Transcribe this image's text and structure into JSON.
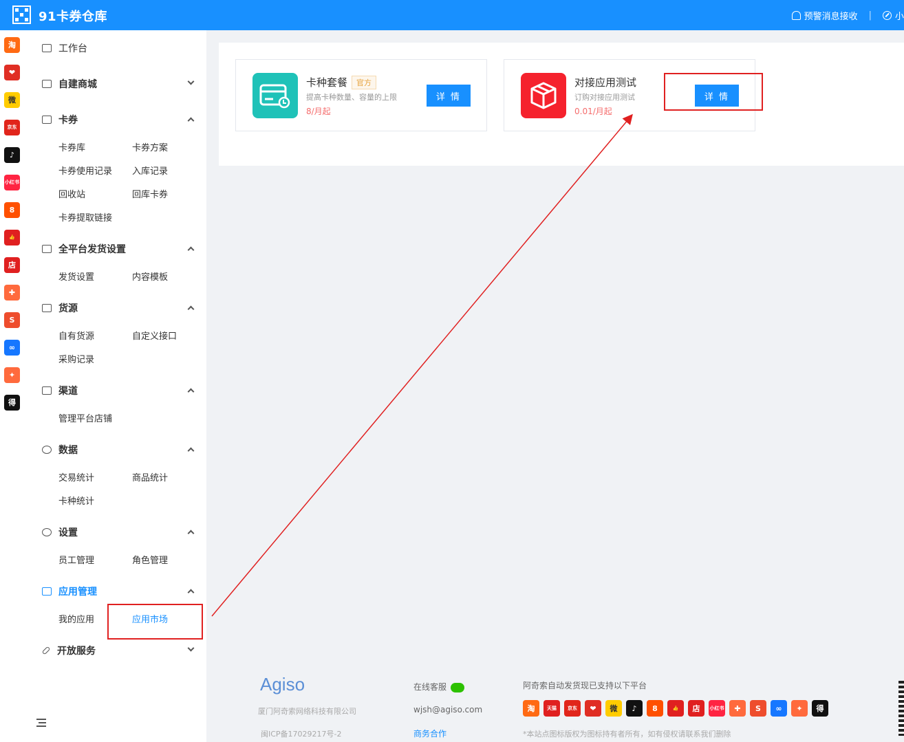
{
  "header": {
    "title": "91卡券仓库",
    "alert_label": "预警消息接收",
    "separator": "|",
    "user_label": "小"
  },
  "platform_strip": [
    {
      "icon": "taobao-icon",
      "glyph": "淘",
      "color": "#ff6a13"
    },
    {
      "icon": "pinduoduo-icon",
      "glyph": "❤",
      "color": "#e02e24"
    },
    {
      "icon": "weimob-icon",
      "glyph": "微",
      "color": "#ffcc00"
    },
    {
      "icon": "jd-icon",
      "glyph": "京东",
      "color": "#e1251b"
    },
    {
      "icon": "douyin-icon",
      "glyph": "♪",
      "color": "#111111"
    },
    {
      "icon": "xiaohongshu-icon",
      "glyph": "小红书",
      "color": "#ff2442"
    },
    {
      "icon": "kuaishou-icon",
      "glyph": "8",
      "color": "#ff5000"
    },
    {
      "icon": "thumbs-up-icon",
      "glyph": "👍",
      "color": "#e02020"
    },
    {
      "icon": "shop-icon",
      "glyph": "店",
      "color": "#e02020"
    },
    {
      "icon": "bag-icon",
      "glyph": "✚",
      "color": "#ff6a3d"
    },
    {
      "icon": "shopee-icon",
      "glyph": "S",
      "color": "#ee4d2d"
    },
    {
      "icon": "link-icon",
      "glyph": "∞",
      "color": "#1677ff"
    },
    {
      "icon": "gift-icon",
      "glyph": "✦",
      "color": "#ff6a3d"
    },
    {
      "icon": "dewu-icon",
      "glyph": "得",
      "color": "#111111"
    }
  ],
  "sidebar": {
    "workbench": "工作台",
    "sections": [
      {
        "label": "自建商城",
        "expanded": false,
        "items": []
      },
      {
        "label": "卡券",
        "expanded": true,
        "items": [
          "卡券库",
          "卡券方案",
          "卡券使用记录",
          "入库记录",
          "回收站",
          "回库卡券",
          "卡券提取链接"
        ]
      },
      {
        "label": "全平台发货设置",
        "expanded": true,
        "items": [
          "发货设置",
          "内容模板"
        ]
      },
      {
        "label": "货源",
        "expanded": true,
        "items": [
          "自有货源",
          "自定义接口",
          "采购记录"
        ]
      },
      {
        "label": "渠道",
        "expanded": true,
        "items": [
          "管理平台店铺"
        ]
      },
      {
        "label": "数据",
        "expanded": true,
        "items": [
          "交易统计",
          "商品统计",
          "卡种统计"
        ]
      },
      {
        "label": "设置",
        "expanded": true,
        "items": [
          "员工管理",
          "角色管理"
        ]
      },
      {
        "label": "应用管理",
        "expanded": true,
        "active": true,
        "items": [
          "我的应用",
          "应用市场"
        ],
        "active_item": "应用市场"
      },
      {
        "label": "开放服务",
        "expanded": false,
        "items": []
      }
    ]
  },
  "apps": [
    {
      "name": "卡种套餐",
      "badge": "官方",
      "desc": "提高卡种数量、容量的上限",
      "price": "8/月起",
      "button": "详 情",
      "icon": "card-package-icon",
      "color": "#1fc2b8"
    },
    {
      "name": "对接应用测试",
      "badge": "",
      "desc": "订购对接应用测试",
      "price": "0.01/月起",
      "button": "详 情",
      "icon": "cube-icon",
      "color": "#f5222d"
    }
  ],
  "footer": {
    "brand": "Agiso",
    "company": "厦门阿奇索网络科技有限公司",
    "icp": "闽ICP备17029217号-2",
    "service": "在线客服",
    "email": "wjsh@agiso.com",
    "business": "商务合作",
    "platforms_title": "阿奇索自动发货现已支持以下平台",
    "disclaimer": "*本站点图标版权为图标持有者所有，如有侵权请联系我们删除",
    "platform_icons": [
      {
        "icon": "taobao-icon",
        "glyph": "淘",
        "color": "#ff6a13"
      },
      {
        "icon": "tmall-icon",
        "glyph": "天猫",
        "color": "#e02020"
      },
      {
        "icon": "jd-icon",
        "glyph": "京东",
        "color": "#e1251b"
      },
      {
        "icon": "pinduoduo-icon",
        "glyph": "❤",
        "color": "#e02e24"
      },
      {
        "icon": "weimob-icon",
        "glyph": "微",
        "color": "#ffcc00"
      },
      {
        "icon": "douyin-icon",
        "glyph": "♪",
        "color": "#111111"
      },
      {
        "icon": "kuaishou-icon",
        "glyph": "8",
        "color": "#ff5000"
      },
      {
        "icon": "thumbs-up-icon",
        "glyph": "👍",
        "color": "#e02020"
      },
      {
        "icon": "shop-icon",
        "glyph": "店",
        "color": "#e02020"
      },
      {
        "icon": "xiaohongshu-icon",
        "glyph": "小红书",
        "color": "#ff2442"
      },
      {
        "icon": "bag-icon",
        "glyph": "✚",
        "color": "#ff6a3d"
      },
      {
        "icon": "shopee-icon",
        "glyph": "S",
        "color": "#ee4d2d"
      },
      {
        "icon": "link-icon",
        "glyph": "∞",
        "color": "#1677ff"
      },
      {
        "icon": "gift-icon",
        "glyph": "✦",
        "color": "#ff6a3d"
      },
      {
        "icon": "dewu-icon",
        "glyph": "得",
        "color": "#111111"
      }
    ]
  }
}
